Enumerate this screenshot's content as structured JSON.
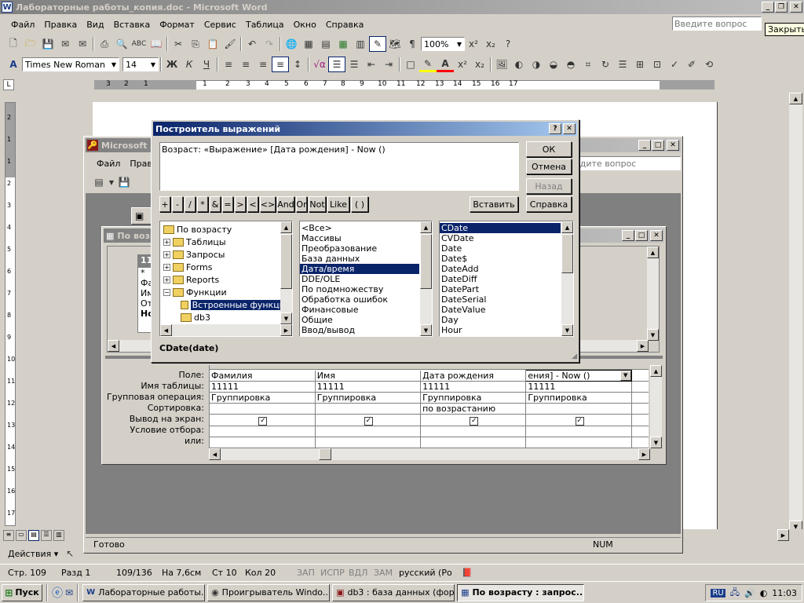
{
  "word": {
    "title": "Лабораторные работы_копия.doc - Microsoft Word",
    "menu": [
      "Файл",
      "Правка",
      "Вид",
      "Вставка",
      "Формат",
      "Сервис",
      "Таблица",
      "Окно",
      "Справка"
    ],
    "help_placeholder": "Введите вопрос",
    "close_tooltip": "Закрыть",
    "zoom": "100%",
    "font_name": "Times New Roman",
    "font_size": "14",
    "fmt_bold": "Ж",
    "fmt_italic": "К",
    "fmt_underline": "Ч",
    "ruler_numbers": [
      "3",
      "2",
      "1",
      "1",
      "2",
      "3",
      "4",
      "5",
      "6",
      "7",
      "8",
      "9",
      "10",
      "11",
      "12",
      "13",
      "14",
      "15",
      "16",
      "17"
    ],
    "vruler_numbers": [
      "2",
      "1",
      "1",
      "2",
      "3",
      "4",
      "5",
      "6",
      "7",
      "8",
      "9",
      "10",
      "11",
      "12",
      "13",
      "14",
      "15",
      "16",
      "17"
    ],
    "draw_label": "Действия ▾",
    "status": {
      "page": "Стр. 109",
      "section": "Разд 1",
      "pages": "109/136",
      "at": "На 7,6см",
      "line": "Ст 10",
      "col": "Кол 20",
      "rec": "ЗАП",
      "trk": "ИСПР",
      "ext": "ВДЛ",
      "ovr": "ЗАМ",
      "lang": "русский (Ро"
    }
  },
  "access": {
    "title": "Microsoft A",
    "menu": [
      "Файл",
      "Прав"
    ],
    "help_placeholder": "едите вопрос",
    "query_title": "По возра",
    "table_name": "11",
    "table_fields": [
      "*",
      "Фа",
      "Им",
      "От",
      "Но"
    ],
    "status_ready": "Готово",
    "status_num": "NUM",
    "grid": {
      "row_labels": [
        "Поле:",
        "Имя таблицы:",
        "Групповая операция:",
        "Сортировка:",
        "Вывод на экран:",
        "Условие отбора:",
        "или:"
      ],
      "columns": [
        {
          "field": "Фамилия",
          "table": "11111",
          "group": "Группировка",
          "sort": "",
          "show": true
        },
        {
          "field": "Имя",
          "table": "11111",
          "group": "Группировка",
          "sort": "",
          "show": true
        },
        {
          "field": "Дата рождения",
          "table": "11111",
          "group": "Группировка",
          "sort": "по возрастанию",
          "show": true
        },
        {
          "field": "ения] - Now ()",
          "table": "11111",
          "group": "Группировка",
          "sort": "",
          "show": true
        },
        {
          "field": "",
          "table": "",
          "group": "",
          "sort": "",
          "show": false
        }
      ]
    }
  },
  "builder": {
    "title": "Построитель выражений",
    "expression": "Возраст: «Выражение» [Дата рождения] - Now ()",
    "buttons": {
      "ok": "ОК",
      "cancel": "Отмена",
      "back": "Назад",
      "paste": "Вставить",
      "help": "Справка"
    },
    "operators": [
      "+",
      "-",
      "/",
      "*",
      "&",
      "=",
      ">",
      "<",
      "<>",
      "And",
      "Or",
      "Not",
      "Like",
      "( )"
    ],
    "tree": [
      {
        "label": "По возрасту",
        "icon": "folder"
      },
      {
        "label": "Таблицы",
        "icon": "plus"
      },
      {
        "label": "Запросы",
        "icon": "plus"
      },
      {
        "label": "Forms",
        "icon": "plus"
      },
      {
        "label": "Reports",
        "icon": "plus"
      },
      {
        "label": "Функции",
        "icon": "minus"
      },
      {
        "label": "Встроенные функции",
        "icon": "folder-open",
        "selected": true
      },
      {
        "label": "db3",
        "icon": "folder"
      }
    ],
    "categories": [
      "<Все>",
      "Массивы",
      "Преобразование",
      "База данных",
      "Дата/время",
      "DDE/OLE",
      "По подмножеству",
      "Обработка ошибок",
      "Финансовые",
      "Общие",
      "Ввод/вывод"
    ],
    "category_selected": "Дата/время",
    "functions": [
      "CDate",
      "CVDate",
      "Date",
      "Date$",
      "DateAdd",
      "DateDiff",
      "DatePart",
      "DateSerial",
      "DateValue",
      "Day",
      "Hour"
    ],
    "function_selected": "CDate",
    "syntax": "CDate(date)"
  },
  "taskbar": {
    "start": "Пуск",
    "tasks": [
      "Лабораторные работы...",
      "Проигрыватель Windo...",
      "db3 : база данных (фор...",
      "По возрасту : запрос..."
    ],
    "lang": "RU",
    "time": "11:03"
  },
  "colors": {
    "title_active": "#0a246a",
    "title_active_end": "#a6caf0",
    "title_inactive": "#808080",
    "title_inactive_end": "#c0c0c0",
    "face": "#d4d0c8",
    "selection": "#0a246a",
    "desktop": "#808080"
  }
}
